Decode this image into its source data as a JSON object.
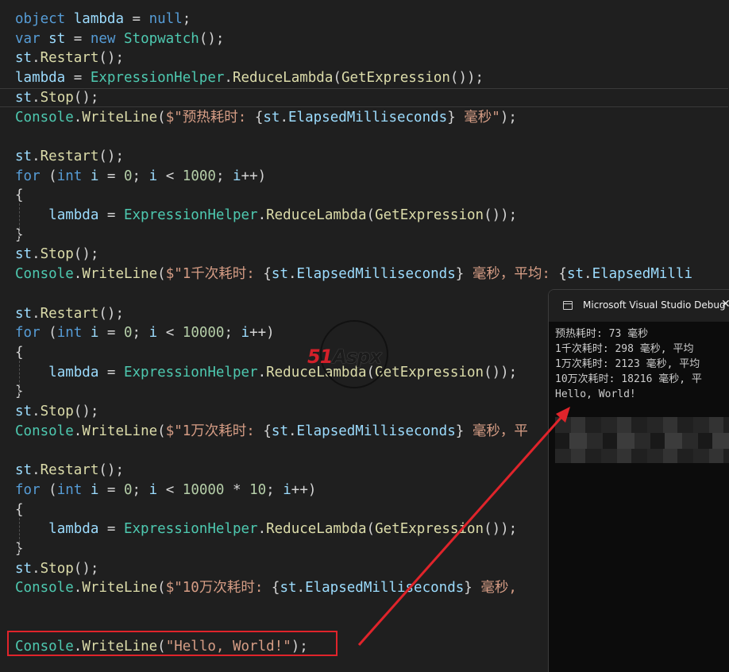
{
  "editor": {
    "lines": [
      [
        [
          "kw",
          "object"
        ],
        [
          "punc",
          " "
        ],
        [
          "var",
          "lambda"
        ],
        [
          "punc",
          " = "
        ],
        [
          "kw",
          "null"
        ],
        [
          "punc",
          ";"
        ]
      ],
      [
        [
          "kw",
          "var"
        ],
        [
          "punc",
          " "
        ],
        [
          "var",
          "st"
        ],
        [
          "punc",
          " = "
        ],
        [
          "kw",
          "new"
        ],
        [
          "punc",
          " "
        ],
        [
          "type",
          "Stopwatch"
        ],
        [
          "punc",
          "();"
        ]
      ],
      [
        [
          "var",
          "st"
        ],
        [
          "punc",
          "."
        ],
        [
          "meth",
          "Restart"
        ],
        [
          "punc",
          "();"
        ]
      ],
      [
        [
          "var",
          "lambda"
        ],
        [
          "punc",
          " = "
        ],
        [
          "type",
          "ExpressionHelper"
        ],
        [
          "punc",
          "."
        ],
        [
          "meth",
          "ReduceLambda"
        ],
        [
          "punc",
          "("
        ],
        [
          "meth",
          "GetExpression"
        ],
        [
          "punc",
          "());"
        ]
      ],
      [
        [
          "var",
          "st"
        ],
        [
          "punc",
          "."
        ],
        [
          "meth",
          "Stop"
        ],
        [
          "punc",
          "();"
        ]
      ],
      [
        [
          "type",
          "Console"
        ],
        [
          "punc",
          "."
        ],
        [
          "meth",
          "WriteLine"
        ],
        [
          "punc",
          "("
        ],
        [
          "str",
          "$\"预热耗时: "
        ],
        [
          "punc",
          "{"
        ],
        [
          "var",
          "st"
        ],
        [
          "punc",
          "."
        ],
        [
          "var",
          "ElapsedMilliseconds"
        ],
        [
          "punc",
          "}"
        ],
        [
          "str",
          " 毫秒\""
        ],
        [
          "punc",
          ");"
        ]
      ],
      [],
      [
        [
          "var",
          "st"
        ],
        [
          "punc",
          "."
        ],
        [
          "meth",
          "Restart"
        ],
        [
          "punc",
          "();"
        ]
      ],
      [
        [
          "ctrl",
          "for"
        ],
        [
          "punc",
          " ("
        ],
        [
          "kw",
          "int"
        ],
        [
          "punc",
          " "
        ],
        [
          "var",
          "i"
        ],
        [
          "punc",
          " = "
        ],
        [
          "num",
          "0"
        ],
        [
          "punc",
          "; "
        ],
        [
          "var",
          "i"
        ],
        [
          "punc",
          " < "
        ],
        [
          "num",
          "1000"
        ],
        [
          "punc",
          "; "
        ],
        [
          "var",
          "i"
        ],
        [
          "punc",
          "++)"
        ]
      ],
      [
        [
          "punc",
          "{"
        ]
      ],
      [
        [
          "punc",
          "    "
        ],
        [
          "var",
          "lambda"
        ],
        [
          "punc",
          " = "
        ],
        [
          "type",
          "ExpressionHelper"
        ],
        [
          "punc",
          "."
        ],
        [
          "meth",
          "ReduceLambda"
        ],
        [
          "punc",
          "("
        ],
        [
          "meth",
          "GetExpression"
        ],
        [
          "punc",
          "());"
        ]
      ],
      [
        [
          "punc",
          "}"
        ]
      ],
      [
        [
          "var",
          "st"
        ],
        [
          "punc",
          "."
        ],
        [
          "meth",
          "Stop"
        ],
        [
          "punc",
          "();"
        ]
      ],
      [
        [
          "type",
          "Console"
        ],
        [
          "punc",
          "."
        ],
        [
          "meth",
          "WriteLine"
        ],
        [
          "punc",
          "("
        ],
        [
          "str",
          "$\"1千次耗时: "
        ],
        [
          "punc",
          "{"
        ],
        [
          "var",
          "st"
        ],
        [
          "punc",
          "."
        ],
        [
          "var",
          "ElapsedMilliseconds"
        ],
        [
          "punc",
          "}"
        ],
        [
          "str",
          " 毫秒，平均: "
        ],
        [
          "punc",
          "{"
        ],
        [
          "var",
          "st"
        ],
        [
          "punc",
          "."
        ],
        [
          "var",
          "ElapsedMilli"
        ]
      ],
      [],
      [
        [
          "var",
          "st"
        ],
        [
          "punc",
          "."
        ],
        [
          "meth",
          "Restart"
        ],
        [
          "punc",
          "();"
        ]
      ],
      [
        [
          "ctrl",
          "for"
        ],
        [
          "punc",
          " ("
        ],
        [
          "kw",
          "int"
        ],
        [
          "punc",
          " "
        ],
        [
          "var",
          "i"
        ],
        [
          "punc",
          " = "
        ],
        [
          "num",
          "0"
        ],
        [
          "punc",
          "; "
        ],
        [
          "var",
          "i"
        ],
        [
          "punc",
          " < "
        ],
        [
          "num",
          "10000"
        ],
        [
          "punc",
          "; "
        ],
        [
          "var",
          "i"
        ],
        [
          "punc",
          "++)"
        ]
      ],
      [
        [
          "punc",
          "{"
        ]
      ],
      [
        [
          "punc",
          "    "
        ],
        [
          "var",
          "lambda"
        ],
        [
          "punc",
          " = "
        ],
        [
          "type",
          "ExpressionHelper"
        ],
        [
          "punc",
          "."
        ],
        [
          "meth",
          "ReduceLambda"
        ],
        [
          "punc",
          "("
        ],
        [
          "meth",
          "GetExpression"
        ],
        [
          "punc",
          "());"
        ]
      ],
      [
        [
          "punc",
          "}"
        ]
      ],
      [
        [
          "var",
          "st"
        ],
        [
          "punc",
          "."
        ],
        [
          "meth",
          "Stop"
        ],
        [
          "punc",
          "();"
        ]
      ],
      [
        [
          "type",
          "Console"
        ],
        [
          "punc",
          "."
        ],
        [
          "meth",
          "WriteLine"
        ],
        [
          "punc",
          "("
        ],
        [
          "str",
          "$\"1万次耗时: "
        ],
        [
          "punc",
          "{"
        ],
        [
          "var",
          "st"
        ],
        [
          "punc",
          "."
        ],
        [
          "var",
          "ElapsedMilliseconds"
        ],
        [
          "punc",
          "}"
        ],
        [
          "str",
          " 毫秒，平"
        ]
      ],
      [],
      [
        [
          "var",
          "st"
        ],
        [
          "punc",
          "."
        ],
        [
          "meth",
          "Restart"
        ],
        [
          "punc",
          "();"
        ]
      ],
      [
        [
          "ctrl",
          "for"
        ],
        [
          "punc",
          " ("
        ],
        [
          "kw",
          "int"
        ],
        [
          "punc",
          " "
        ],
        [
          "var",
          "i"
        ],
        [
          "punc",
          " = "
        ],
        [
          "num",
          "0"
        ],
        [
          "punc",
          "; "
        ],
        [
          "var",
          "i"
        ],
        [
          "punc",
          " < "
        ],
        [
          "num",
          "10000"
        ],
        [
          "punc",
          " * "
        ],
        [
          "num",
          "10"
        ],
        [
          "punc",
          "; "
        ],
        [
          "var",
          "i"
        ],
        [
          "punc",
          "++)"
        ]
      ],
      [
        [
          "punc",
          "{"
        ]
      ],
      [
        [
          "punc",
          "    "
        ],
        [
          "var",
          "lambda"
        ],
        [
          "punc",
          " = "
        ],
        [
          "type",
          "ExpressionHelper"
        ],
        [
          "punc",
          "."
        ],
        [
          "meth",
          "ReduceLambda"
        ],
        [
          "punc",
          "("
        ],
        [
          "meth",
          "GetExpression"
        ],
        [
          "punc",
          "());"
        ]
      ],
      [
        [
          "punc",
          "}"
        ]
      ],
      [
        [
          "var",
          "st"
        ],
        [
          "punc",
          "."
        ],
        [
          "meth",
          "Stop"
        ],
        [
          "punc",
          "();"
        ]
      ],
      [
        [
          "type",
          "Console"
        ],
        [
          "punc",
          "."
        ],
        [
          "meth",
          "WriteLine"
        ],
        [
          "punc",
          "("
        ],
        [
          "str",
          "$\"10万次耗时: "
        ],
        [
          "punc",
          "{"
        ],
        [
          "var",
          "st"
        ],
        [
          "punc",
          "."
        ],
        [
          "var",
          "ElapsedMilliseconds"
        ],
        [
          "punc",
          "}"
        ],
        [
          "str",
          " 毫秒,"
        ]
      ],
      [],
      [],
      [
        [
          "type",
          "Console"
        ],
        [
          "punc",
          "."
        ],
        [
          "meth",
          "WriteLine"
        ],
        [
          "punc",
          "("
        ],
        [
          "str",
          "\"Hello, World!\""
        ],
        [
          "punc",
          ");"
        ]
      ]
    ],
    "current_line": 4
  },
  "console": {
    "title": "Microsoft Visual Studio Debug",
    "close_glyph": "✕",
    "output": [
      "预热耗时: 73 毫秒",
      "1千次耗时: 298 毫秒, 平均",
      "1万次耗时: 2123 毫秒, 平均",
      "10万次耗时: 18216 毫秒, 平",
      "Hello, World!"
    ]
  },
  "watermark": {
    "part_a": "51",
    "part_b": "Aspx"
  },
  "colors": {
    "annotation_red": "#e0242b"
  }
}
